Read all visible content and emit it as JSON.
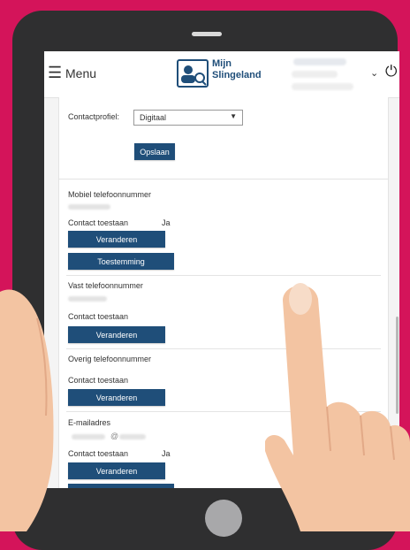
{
  "header": {
    "menu_label": "Menu",
    "logo_text": "Mijn\nSlingeland"
  },
  "profile_card": {
    "contact_profile_label": "Contactprofiel:",
    "contact_profile_value": "Digitaal",
    "save_label": "Opslaan"
  },
  "contact_card": {
    "mobile": {
      "title": "Mobiel telefoonnummer",
      "permission_label": "Contact toestaan",
      "permission_value": "Ja",
      "change_label": "Veranderen",
      "consent_label": "Toestemming"
    },
    "landline": {
      "title": "Vast telefoonnummer",
      "permission_label": "Contact toestaan",
      "change_label": "Veranderen"
    },
    "other": {
      "title": "Overig telefoonnummer",
      "permission_label": "Contact toestaan",
      "change_label": "Veranderen"
    },
    "email": {
      "title": "E-mailadres",
      "value_fragment": "@",
      "permission_label": "Contact toestaan",
      "permission_value": "Ja",
      "change_label": "Veranderen"
    }
  },
  "colors": {
    "background": "#d4145a",
    "tablet": "#2f2f30",
    "button": "#1f4e79"
  }
}
